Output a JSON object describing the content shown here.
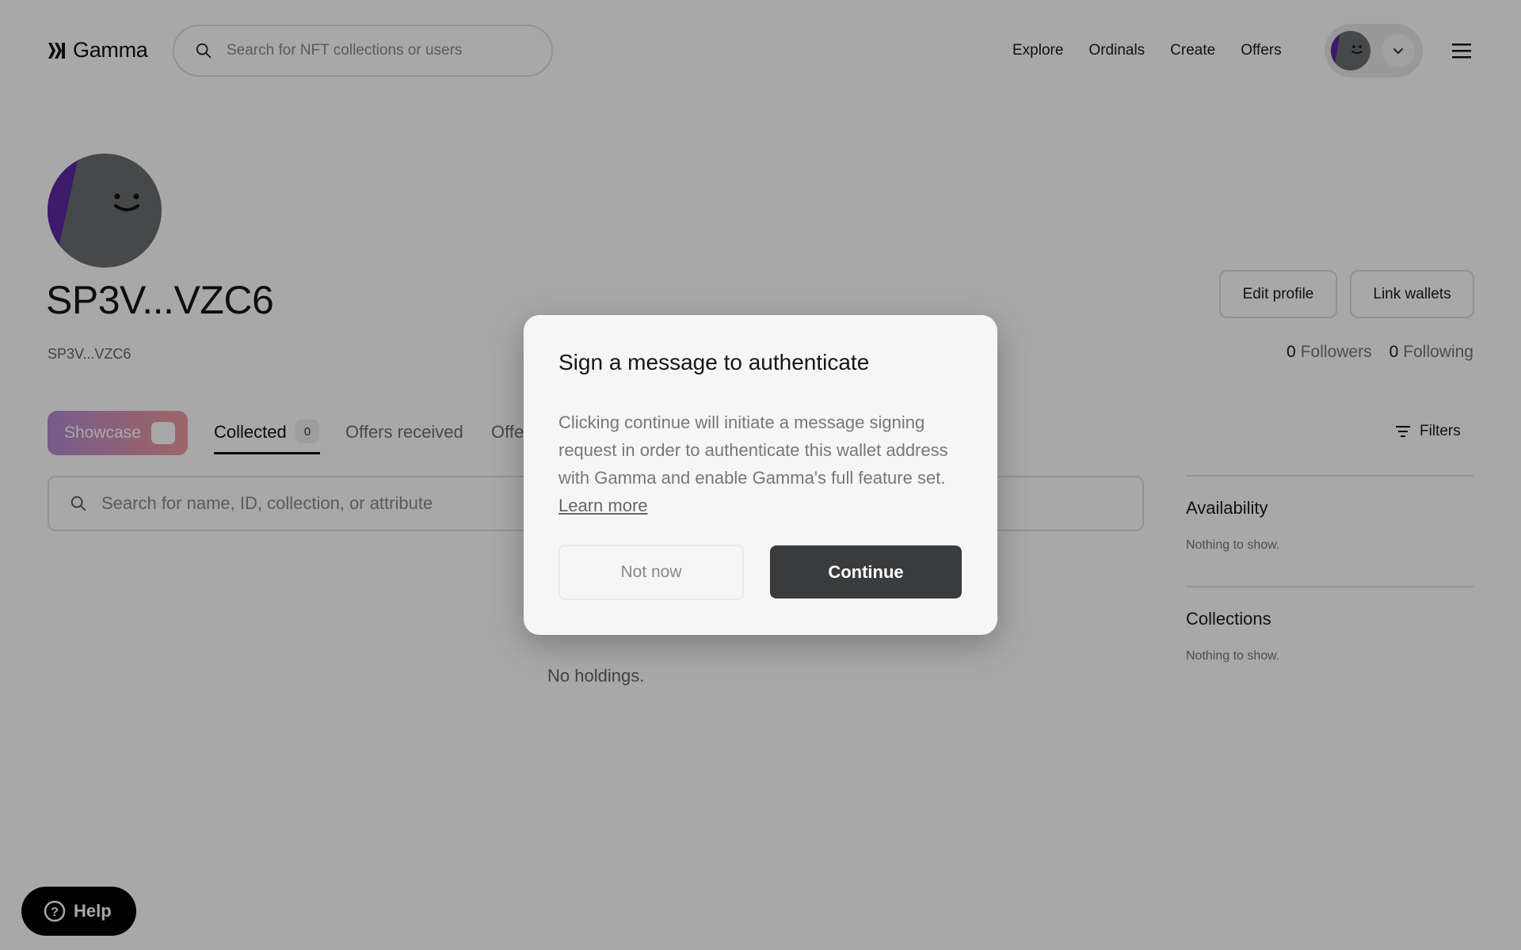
{
  "header": {
    "logo_text": "Gamma",
    "search_placeholder": "Search for NFT collections or users",
    "nav": [
      "Explore",
      "Ordinals",
      "Create",
      "Offers"
    ]
  },
  "profile": {
    "name": "SP3V...VZC6",
    "address": "SP3V...VZC6",
    "edit_profile_label": "Edit profile",
    "link_wallets_label": "Link wallets",
    "followers_count": "0",
    "followers_label": "Followers",
    "following_count": "0",
    "following_label": "Following"
  },
  "tabs": {
    "showcase_label": "Showcase",
    "collected_label": "Collected",
    "collected_count": "0",
    "offers_received_label": "Offers received",
    "offers_made_partial": "Offe",
    "filters_label": "Filters"
  },
  "items": {
    "search_placeholder": "Search for name, ID, collection, or attribute",
    "empty_text": "No holdings."
  },
  "sidebar": {
    "availability_title": "Availability",
    "availability_empty": "Nothing to show.",
    "collections_title": "Collections",
    "collections_empty": "Nothing to show."
  },
  "help": {
    "label": "Help"
  },
  "modal": {
    "title": "Sign a message to authenticate",
    "body": "Clicking continue will initiate a message signing request in order to authenticate this wallet address with Gamma and enable Gamma's full feature set.",
    "learn_more": "Learn more",
    "not_now_label": "Not now",
    "continue_label": "Continue"
  },
  "colors": {
    "overlay": "rgba(0,0,0,0.34)",
    "continue_bg": "#3a3b3d",
    "avatar_bg": "#6b6e70",
    "avatar_accent": "#5b2aa3"
  }
}
